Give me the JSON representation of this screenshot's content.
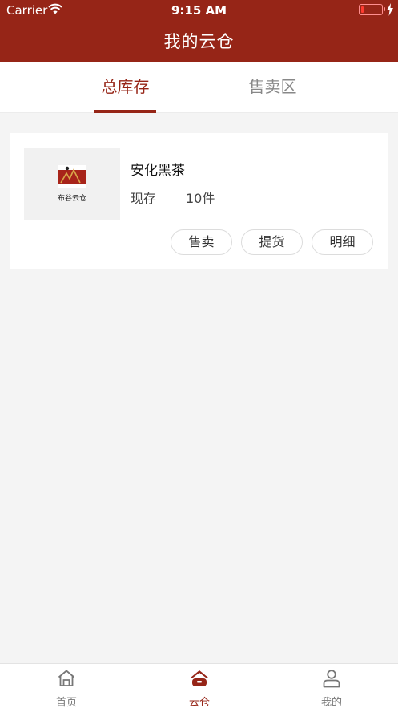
{
  "status_bar": {
    "carrier": "Carrier",
    "time": "9:15 AM"
  },
  "nav": {
    "title": "我的云仓"
  },
  "tabs": [
    {
      "label": "总库存",
      "active": true
    },
    {
      "label": "售卖区",
      "active": false
    }
  ],
  "inventory": [
    {
      "logo_text": "布谷云仓",
      "name": "安化黑茶",
      "stock_label": "现存",
      "stock_value": "10件",
      "actions": {
        "sell": "售卖",
        "pickup": "提货",
        "detail": "明细"
      }
    }
  ],
  "tabbar": {
    "items": [
      {
        "label": "首页",
        "icon": "home-icon",
        "active": false
      },
      {
        "label": "云仓",
        "icon": "warehouse-icon",
        "active": true
      },
      {
        "label": "我的",
        "icon": "person-icon",
        "active": false
      }
    ]
  },
  "colors": {
    "brand": "#962517",
    "background": "#f4f4f4",
    "inactive": "#888888"
  }
}
